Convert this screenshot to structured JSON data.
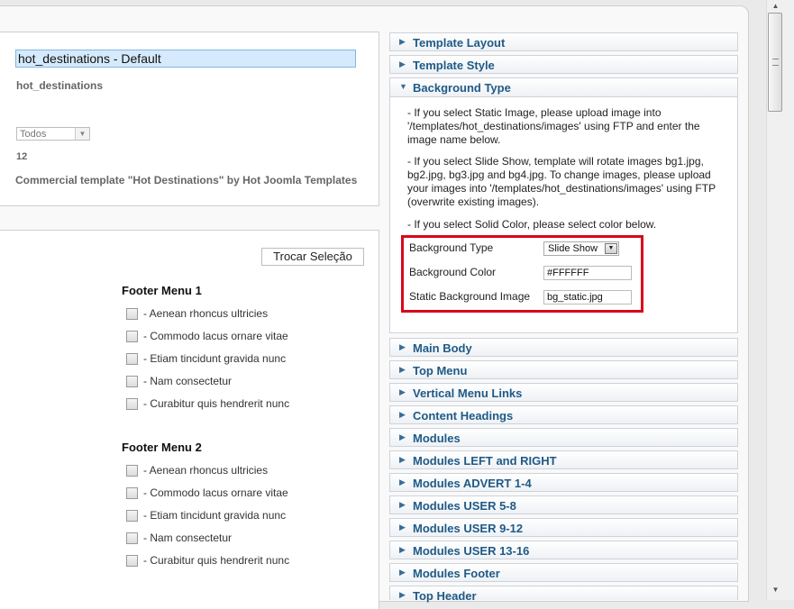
{
  "details": {
    "template_name_value": "hot_destinations - Default",
    "template_id": "hot_destinations",
    "client_select": "Todos",
    "count": "12",
    "description": "Commercial template \"Hot Destinations\" by Hot Joomla Templates"
  },
  "menu_assignment": {
    "swap_button": "Trocar Seleção",
    "menus": [
      {
        "title": "Footer Menu 1",
        "items": [
          "- Aenean rhoncus ultricies",
          "- Commodo lacus ornare vitae",
          "- Etiam tincidunt gravida nunc",
          "- Nam consectetur",
          "- Curabitur quis hendrerit nunc"
        ]
      },
      {
        "title": "Footer Menu 2",
        "items": [
          "- Aenean rhoncus ultricies",
          "- Commodo lacus ornare vitae",
          "- Etiam tincidunt gravida nunc",
          "- Nam consectetur",
          "- Curabitur quis hendrerit nunc"
        ]
      }
    ]
  },
  "panes": [
    {
      "label": "Template Layout",
      "arrow": "▶"
    },
    {
      "label": "Template Style",
      "arrow": "▶"
    },
    {
      "label": "Background Type",
      "arrow": "▼"
    },
    {
      "label": "Main Body",
      "arrow": "▶"
    },
    {
      "label": "Top Menu",
      "arrow": "▶"
    },
    {
      "label": "Vertical Menu Links",
      "arrow": "▶"
    },
    {
      "label": "Content Headings",
      "arrow": "▶"
    },
    {
      "label": "Modules",
      "arrow": "▶"
    },
    {
      "label": "Modules LEFT and RIGHT",
      "arrow": "▶"
    },
    {
      "label": "Modules ADVERT 1-4",
      "arrow": "▶"
    },
    {
      "label": "Modules USER 5-8",
      "arrow": "▶"
    },
    {
      "label": "Modules USER 9-12",
      "arrow": "▶"
    },
    {
      "label": "Modules USER 13-16",
      "arrow": "▶"
    },
    {
      "label": "Modules Footer",
      "arrow": "▶"
    },
    {
      "label": "Top Header",
      "arrow": "▶"
    }
  ],
  "background_pane": {
    "info_static": "- If you select Static Image, please upload image into '/templates/hot_destinations/images' using FTP and enter the image name below.",
    "info_slideshow": "- If you select Slide Show, template will rotate images bg1.jpg, bg2.jpg, bg3.jpg and bg4.jpg. To change images, please upload your images into '/templates/hot_destinations/images' using FTP (overwrite existing images).",
    "info_solid": "- If you select Solid Color, please select color below.",
    "params": {
      "type_label": "Background Type",
      "type_value": "Slide Show",
      "color_label": "Background Color",
      "color_value": "#FFFFFF",
      "image_label": "Static Background Image",
      "image_value": "bg_static.jpg"
    }
  },
  "colors": {
    "pane_title": "#1f5a86",
    "highlight_border": "#d9061b",
    "name_field_bg": "#d5eafc"
  }
}
